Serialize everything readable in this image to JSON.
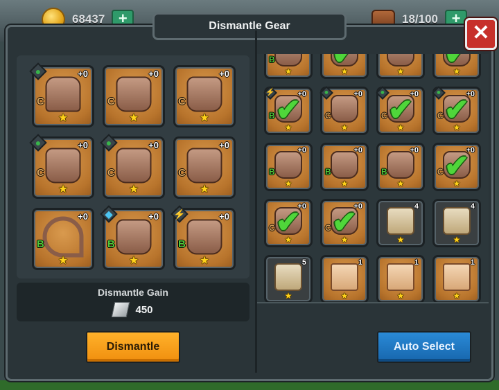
{
  "hud": {
    "coins": "68437",
    "bag_capacity": "18/100",
    "plus_symbol": "+"
  },
  "dialog": {
    "title": "Dismantle Gear",
    "close_symbol": "✕"
  },
  "selected_slots": [
    {
      "art": "armor",
      "grade": "C",
      "level": "+0",
      "badge": "leaf"
    },
    {
      "art": "fist",
      "grade": "C",
      "level": "+0",
      "badge": ""
    },
    {
      "art": "fist",
      "grade": "C",
      "level": "+0",
      "badge": ""
    },
    {
      "art": "fist",
      "grade": "C",
      "level": "+0",
      "badge": "leaf"
    },
    {
      "art": "fist",
      "grade": "C",
      "level": "+0",
      "badge": "leaf"
    },
    {
      "art": "fist",
      "grade": "C",
      "level": "+0",
      "badge": ""
    },
    {
      "art": "bow",
      "grade": "B",
      "level": "+0",
      "badge": ""
    },
    {
      "art": "fist",
      "grade": "B",
      "level": "+0",
      "badge": "diamond"
    },
    {
      "art": "fist",
      "grade": "B",
      "level": "+0",
      "badge": "bolt"
    }
  ],
  "inventory_slots": [
    {
      "kind": "gear",
      "art": "fist",
      "grade": "B",
      "level": "",
      "badge": "",
      "checked": false,
      "partial": true
    },
    {
      "kind": "gear",
      "art": "fist",
      "grade": "",
      "level": "",
      "badge": "",
      "checked": true,
      "partial": true
    },
    {
      "kind": "gear",
      "art": "fist",
      "grade": "",
      "level": "",
      "badge": "",
      "checked": false,
      "partial": true
    },
    {
      "kind": "gear",
      "art": "fist",
      "grade": "",
      "level": "",
      "badge": "",
      "checked": true,
      "partial": true
    },
    {
      "kind": "gear",
      "art": "fist",
      "grade": "B",
      "level": "+0",
      "badge": "bolt",
      "checked": true
    },
    {
      "kind": "gear",
      "art": "fist",
      "grade": "C",
      "level": "+0",
      "badge": "leaf",
      "checked": false
    },
    {
      "kind": "gear",
      "art": "fist",
      "grade": "C",
      "level": "+0",
      "badge": "leaf",
      "checked": true
    },
    {
      "kind": "gear",
      "art": "fist",
      "grade": "C",
      "level": "+0",
      "badge": "leaf",
      "checked": true
    },
    {
      "kind": "gear",
      "art": "fist",
      "grade": "B",
      "level": "+0",
      "badge": "",
      "checked": false
    },
    {
      "kind": "gear",
      "art": "fist",
      "grade": "B",
      "level": "+0",
      "badge": "",
      "checked": false
    },
    {
      "kind": "gear",
      "art": "fist",
      "grade": "B",
      "level": "+0",
      "badge": "",
      "checked": false
    },
    {
      "kind": "gear",
      "art": "fist",
      "grade": "C",
      "level": "+0",
      "badge": "",
      "checked": true
    },
    {
      "kind": "gear",
      "art": "fist",
      "grade": "C",
      "level": "+0",
      "badge": "",
      "checked": true
    },
    {
      "kind": "gear",
      "art": "fist",
      "grade": "C",
      "level": "+0",
      "badge": "",
      "checked": true
    },
    {
      "kind": "dark",
      "art": "blueprint",
      "grade": "",
      "level": "4",
      "badge": "",
      "checked": false
    },
    {
      "kind": "dark",
      "art": "blueprint",
      "grade": "",
      "level": "4",
      "badge": "",
      "checked": false
    },
    {
      "kind": "dark",
      "art": "blueprint",
      "grade": "",
      "level": "5",
      "badge": "",
      "checked": false
    },
    {
      "kind": "gear",
      "art": "scroll",
      "grade": "",
      "level": "1",
      "badge": "",
      "checked": false
    },
    {
      "kind": "gear",
      "art": "scroll",
      "grade": "",
      "level": "1",
      "badge": "",
      "checked": false
    },
    {
      "kind": "gear",
      "art": "scroll",
      "grade": "",
      "level": "1",
      "badge": "",
      "checked": false
    }
  ],
  "gain": {
    "title": "Dismantle Gain",
    "value": "450"
  },
  "buttons": {
    "dismantle": "Dismantle",
    "auto_select": "Auto Select"
  },
  "symbols": {
    "star": "★",
    "check": "✔",
    "leaf": "●",
    "diamond": "◆",
    "bolt": "⚡"
  },
  "colors": {
    "dismantle_button": "#f5a01a",
    "auto_select_button": "#1f78c4",
    "close_button": "#c7302b",
    "check": "#4fd63a",
    "grade_b": "#4ec93a",
    "grade_c": "#d7a45e",
    "leaf_badge": "#38b44a",
    "diamond_badge": "#4cc4f0",
    "bolt_badge": "#f2c21a"
  }
}
